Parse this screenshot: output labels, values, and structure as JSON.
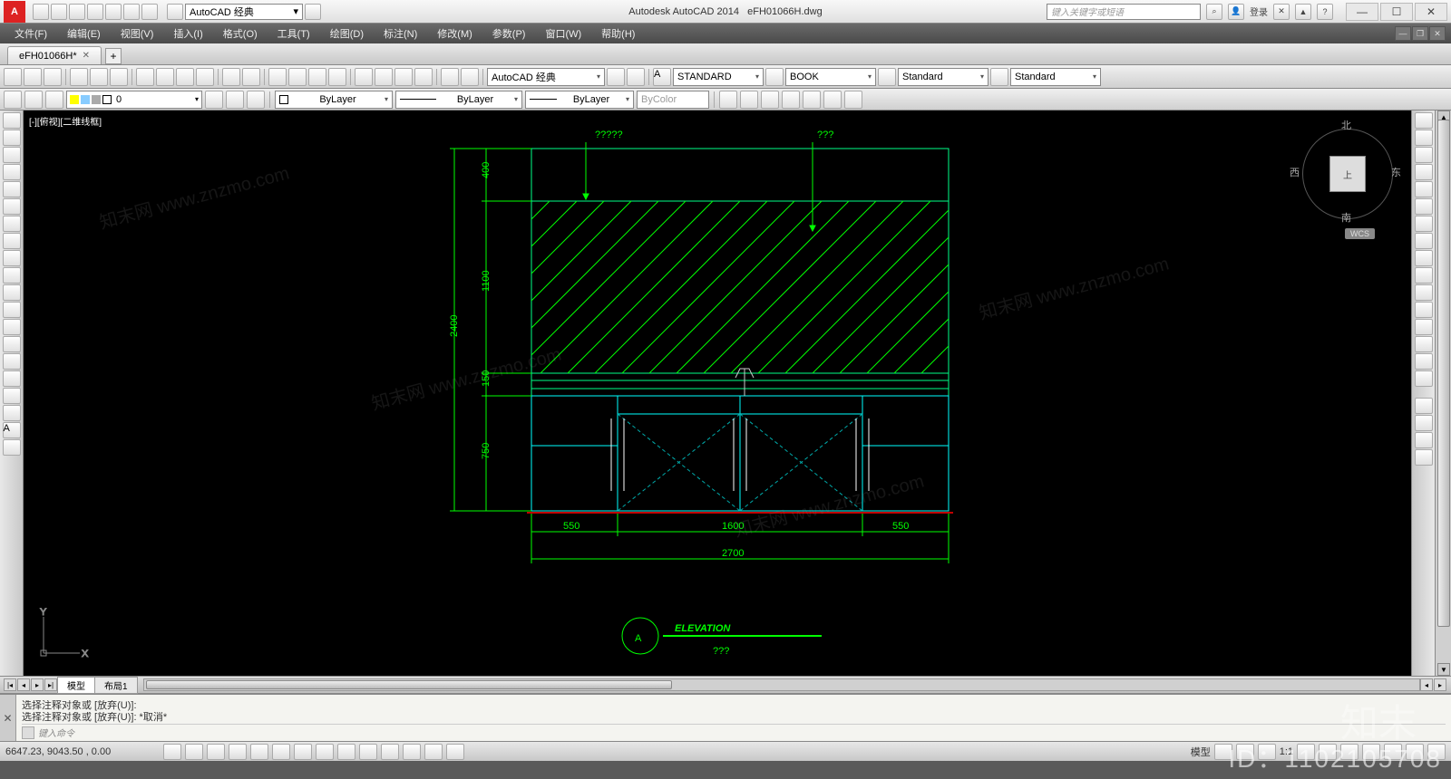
{
  "title": {
    "app": "Autodesk AutoCAD 2014",
    "file": "eFH01066H.dwg",
    "logo": "A"
  },
  "qat_count": 10,
  "workspace": {
    "label": "AutoCAD 经典"
  },
  "search": {
    "placeholder": "键入关键字或短语"
  },
  "signin": "登录",
  "menus": [
    "文件(F)",
    "编辑(E)",
    "视图(V)",
    "插入(I)",
    "格式(O)",
    "工具(T)",
    "绘图(D)",
    "标注(N)",
    "修改(M)",
    "参数(P)",
    "窗口(W)",
    "帮助(H)"
  ],
  "doctab": {
    "name": "eFH01066H*"
  },
  "toolbar": {
    "combo1": "AutoCAD 经典",
    "textstyle": "STANDARD",
    "dimstyle": "BOOK",
    "tablestyle": "Standard",
    "mlstyle": "Standard"
  },
  "props": {
    "layer": "0",
    "color": "ByLayer",
    "linetype": "ByLayer",
    "lineweight": "ByLayer",
    "plotstyle": "ByColor"
  },
  "viewport": {
    "label": "[-][俯视][二维线框]"
  },
  "viewcube": {
    "n": "北",
    "s": "南",
    "e": "东",
    "w": "西",
    "face": "上",
    "wcs": "WCS"
  },
  "drawing": {
    "title": "ELEVATION",
    "tag": "A",
    "subtitle": "???",
    "top_label1": "?????",
    "top_label2": "???",
    "dims_v": {
      "total": "2400",
      "seg1": "400",
      "seg2": "1100",
      "seg3": "150",
      "seg4": "750"
    },
    "dims_h": {
      "total": "2700",
      "seg1": "550",
      "seg2": "1600",
      "seg3": "550"
    }
  },
  "model_tabs": {
    "model": "模型",
    "layout": "布局1"
  },
  "cmd": {
    "line1": "选择注释对象或 [放弃(U)]:",
    "line2": "选择注释对象或 [放弃(U)]: *取消*",
    "prompt": "键入命令"
  },
  "status": {
    "coords": "6647.23, 9043.50 , 0.00",
    "right_label": "模型",
    "scale": "1:1"
  },
  "overlay": {
    "brand": "知末",
    "id": "ID：1102105708",
    "wm": "知末网 www.znzmo.com"
  }
}
